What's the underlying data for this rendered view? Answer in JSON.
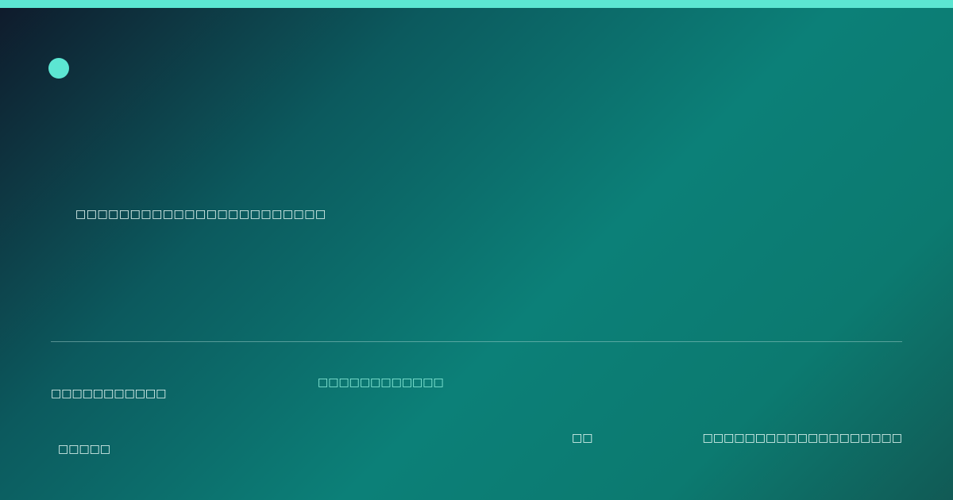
{
  "colors": {
    "accent": "#5ce6d2",
    "text": "#e9fbf7",
    "accent_text": "#8ff2df",
    "background_start": "#0f1a2b",
    "background_mid": "#0c8078",
    "background_end": "#115a55"
  },
  "icons": {
    "brand_mark": "brand-dot-icon"
  },
  "hero": {
    "tagline": "□□□□□□□□□□□□□□□□□□□□□□□"
  },
  "footer": {
    "left_title": "□□□□□□□□□□□",
    "center_label": "□□□□□□□□□□□□",
    "left_subtitle": "□□□□□",
    "middle_text": "□□",
    "right_text": "□□□□□□□□□□□□□□□□□□□"
  }
}
